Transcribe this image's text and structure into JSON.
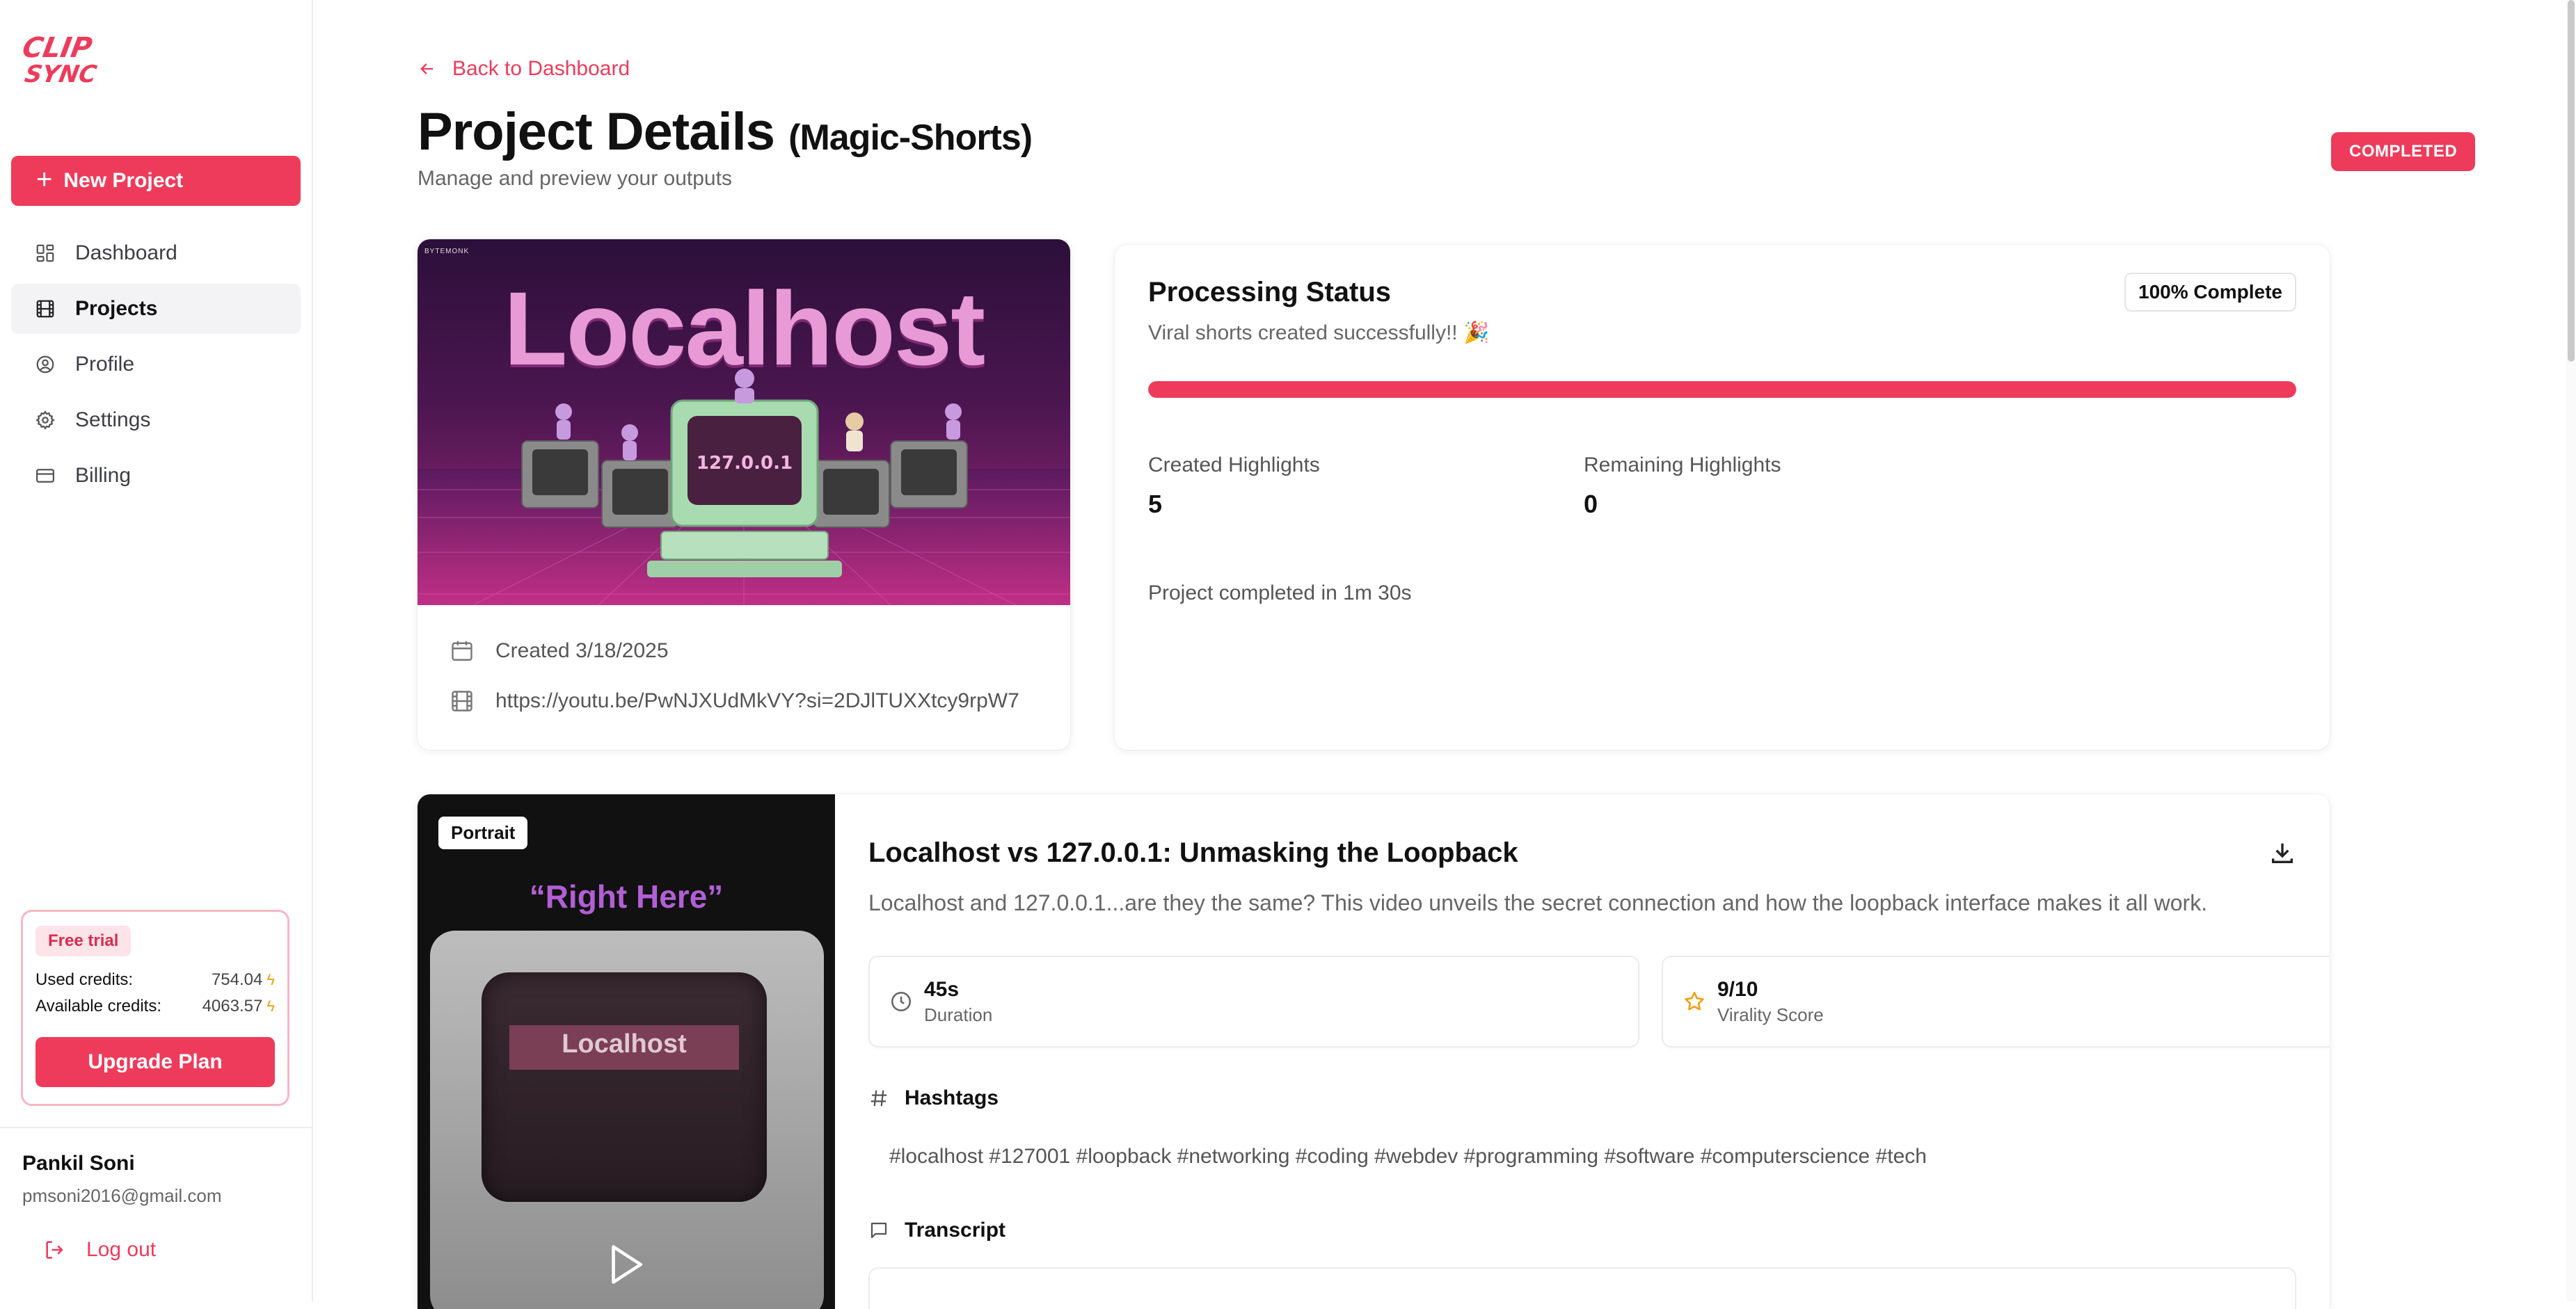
{
  "sidebar": {
    "logo": "CLIP SYNC",
    "new_project": "New Project",
    "items": [
      {
        "label": "Dashboard",
        "icon": "dashboard-icon"
      },
      {
        "label": "Projects",
        "icon": "film-icon"
      },
      {
        "label": "Profile",
        "icon": "user-circle-icon"
      },
      {
        "label": "Settings",
        "icon": "gear-icon"
      },
      {
        "label": "Billing",
        "icon": "credit-card-icon"
      }
    ],
    "active_item": "Projects",
    "trial": {
      "badge": "Free trial",
      "used_label": "Used credits:",
      "used_value": "754.04",
      "available_label": "Available credits:",
      "available_value": "4063.57",
      "upgrade": "Upgrade Plan"
    },
    "user": {
      "name": "Pankil Soni",
      "email": "pmsoni2016@gmail.com"
    },
    "logout": "Log out"
  },
  "header": {
    "back": "Back to Dashboard",
    "title": "Project Details",
    "title_sub": "(Magic-Shorts)",
    "subtitle": "Manage and preview your outputs",
    "status": "COMPLETED"
  },
  "project": {
    "thumbnail_title": "Localhost",
    "thumbnail_brand": "BYTEMONK",
    "thumbnail_ip": "127.0.0.1",
    "created": "Created 3/18/2025",
    "url": "https://youtu.be/PwNJXUdMkVY?si=2DJlTUXXtcy9rpW7"
  },
  "processing": {
    "title": "Processing Status",
    "subtitle": "Viral shorts created successfully!! 🎉",
    "complete_label": "100% Complete",
    "progress": 1.0,
    "created_label": "Created Highlights",
    "created_value": "5",
    "remaining_label": "Remaining Highlights",
    "remaining_value": "0",
    "time": "Project completed in 1m 30s"
  },
  "highlight": {
    "badge": "Portrait",
    "video_quote": "“Right Here”",
    "video_screen": "Localhost",
    "title": "Localhost vs 127.0.0.1: Unmasking the Loopback",
    "description": "Localhost and 127.0.0.1...are they the same? This video unveils the secret connection and how the loopback interface makes it all work.",
    "duration_value": "45s",
    "duration_label": "Duration",
    "virality_value": "9/10",
    "virality_label": "Virality Score",
    "hashtags_label": "Hashtags",
    "hashtags": "#localhost #127001 #loopback #networking #coding #webdev #programming #software #computerscience #tech",
    "transcript_label": "Transcript"
  },
  "colors": {
    "accent": "#ee3b5b",
    "star": "#f59e0b"
  }
}
